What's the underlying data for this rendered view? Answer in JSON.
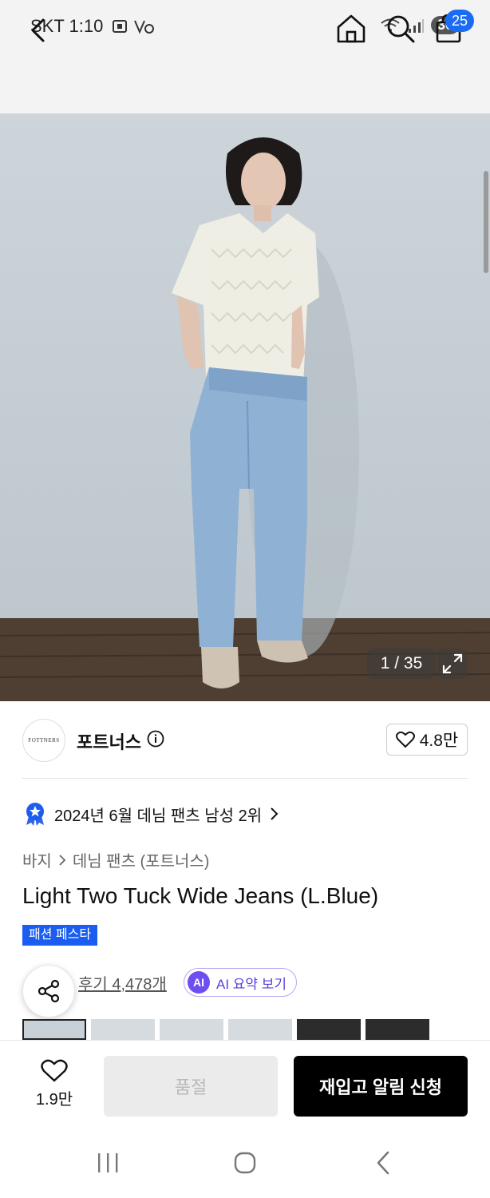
{
  "status_bar": {
    "carrier_time": "SKT 1:10",
    "battery": "30"
  },
  "header": {
    "cart_count": "25"
  },
  "gallery": {
    "counter": "1 / 35"
  },
  "brand": {
    "logo_text": "FOTTNERS",
    "name": "포트너스",
    "likes": "4.8만"
  },
  "ranking": {
    "text": "2024년 6월 데님 팬츠 남성 2위"
  },
  "breadcrumb": {
    "category": "바지",
    "subcategory": "데님 팬츠 (포트너스)"
  },
  "product": {
    "title": "Light Two Tuck Wide Jeans (L.Blue)",
    "event_tag": "패션 페스타",
    "reviews": "후기 4,478개",
    "ai_badge": "AI",
    "ai_summary": "AI 요약 보기"
  },
  "actions": {
    "wish_count": "1.9만",
    "soldout_label": "품절",
    "restock_label": "재입고 알림 신청"
  },
  "colors": {
    "accent_blue": "#1a5df0",
    "ai_purple": "#6e4ef0"
  }
}
